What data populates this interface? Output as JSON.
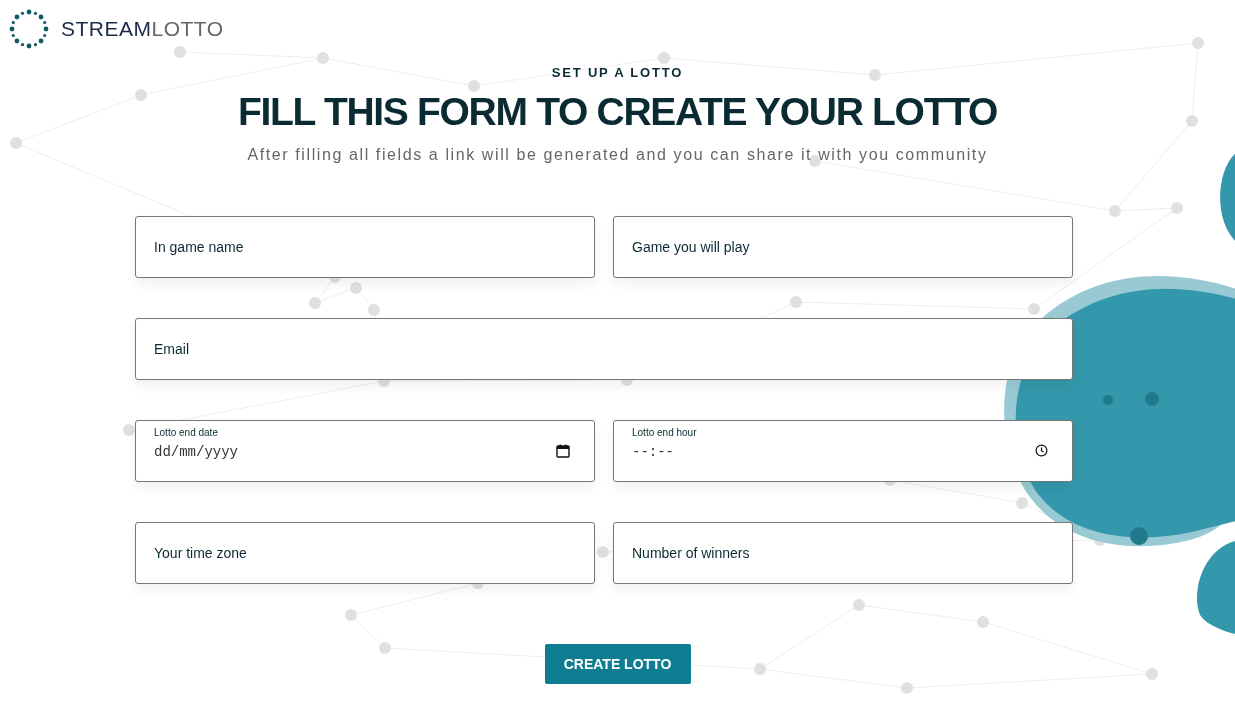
{
  "brand": {
    "name_part_1": "STREAM",
    "name_part_2": "LOTTO"
  },
  "header": {
    "eyebrow": "SET UP A LOTTO",
    "title": "FILL THIS FORM TO CREATE YOUR LOTTO",
    "subtitle": "After filling all fields a link will be generated and you can share it with you community"
  },
  "form": {
    "rows": [
      {
        "fields": [
          {
            "kind": "text",
            "placeholder": "In game name"
          },
          {
            "kind": "text",
            "placeholder": "Game you will play"
          }
        ]
      },
      {
        "fields": [
          {
            "kind": "text",
            "placeholder": "Email"
          }
        ]
      },
      {
        "fields": [
          {
            "kind": "date",
            "label": "Lotto end date",
            "value": "dd/mm/yyyy"
          },
          {
            "kind": "time",
            "label": "Lotto end hour",
            "value": "--:--"
          }
        ]
      },
      {
        "fields": [
          {
            "kind": "text",
            "placeholder": "Your time zone"
          },
          {
            "kind": "text",
            "placeholder": "Number of winners"
          }
        ]
      }
    ]
  },
  "submit_button": "CREATE LOTTO"
}
